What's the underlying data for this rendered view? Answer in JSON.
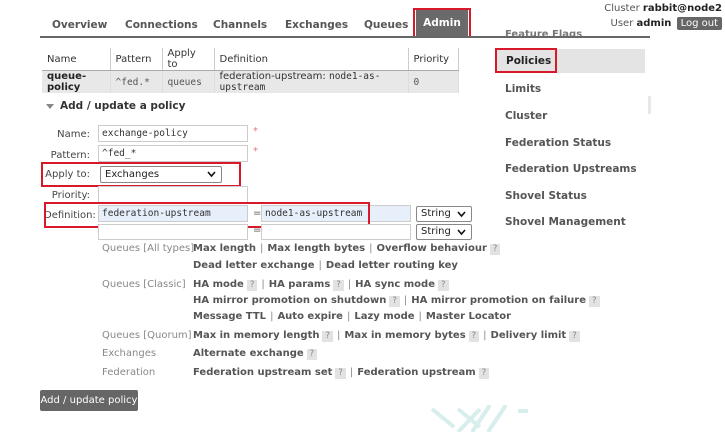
{
  "nav": {
    "tabs": [
      "Overview",
      "Connections",
      "Channels",
      "Exchanges",
      "Queues",
      "Admin"
    ]
  },
  "header": {
    "cluster_label": "Cluster",
    "cluster_name": "rabbit@node2",
    "user_label": "User",
    "user_name": "admin",
    "logout": "Log out",
    "feature_flags_clipped": "Feature Flags"
  },
  "policies_table": {
    "headers": [
      "Name",
      "Pattern",
      "Apply to",
      "Definition",
      "Priority"
    ],
    "rows": [
      {
        "name": "queue-policy",
        "pattern": "^fed.*",
        "apply_to": "queues",
        "def_key": "federation-upstream:",
        "def_value": "node1-as-upstream",
        "priority": "0"
      }
    ]
  },
  "sidebar": {
    "items": [
      "Policies",
      "Limits",
      "Cluster",
      "Federation Status",
      "Federation Upstreams",
      "Shovel Status",
      "Shovel Management"
    ]
  },
  "form": {
    "section_title": "Add / update a policy",
    "name_label": "Name:",
    "name_value": "exchange-policy",
    "pattern_label": "Pattern:",
    "pattern_value": "^fed_*",
    "apply_label": "Apply to:",
    "apply_value": "Exchanges",
    "priority_label": "Priority:",
    "definition_label": "Definition:",
    "def_key": "federation-upstream",
    "def_value": "node1-as-upstream",
    "eq": "=",
    "type_1": "String",
    "type_2": "String",
    "required_mark": "*"
  },
  "help": {
    "queues_all_label": "Queues [All types]",
    "queues_all": [
      "Max length",
      "Max length bytes",
      "Overflow behaviour"
    ],
    "queues_all_2": [
      "Dead letter exchange",
      "Dead letter routing key"
    ],
    "queues_classic_label": "Queues [Classic]",
    "classic_1": [
      "HA mode",
      "HA params",
      "HA sync mode"
    ],
    "classic_2": [
      "HA mirror promotion on shutdown",
      "HA mirror promotion on failure"
    ],
    "classic_3": [
      "Message TTL",
      "Auto expire",
      "Lazy mode",
      "Master Locator"
    ],
    "queues_quorum_label": "Queues [Quorum]",
    "quorum": [
      "Max in memory length",
      "Max in memory bytes",
      "Delivery limit"
    ],
    "exchanges_label": "Exchanges",
    "exchanges": [
      "Alternate exchange"
    ],
    "federation_label": "Federation",
    "federation": [
      "Federation upstream set",
      "Federation upstream"
    ],
    "q": "?",
    "sep": "|"
  },
  "add_button": "Add / update policy",
  "colors": {
    "highlight": "#d8182b",
    "nav_dark": "#666666",
    "input_blue": "#e6effa"
  }
}
